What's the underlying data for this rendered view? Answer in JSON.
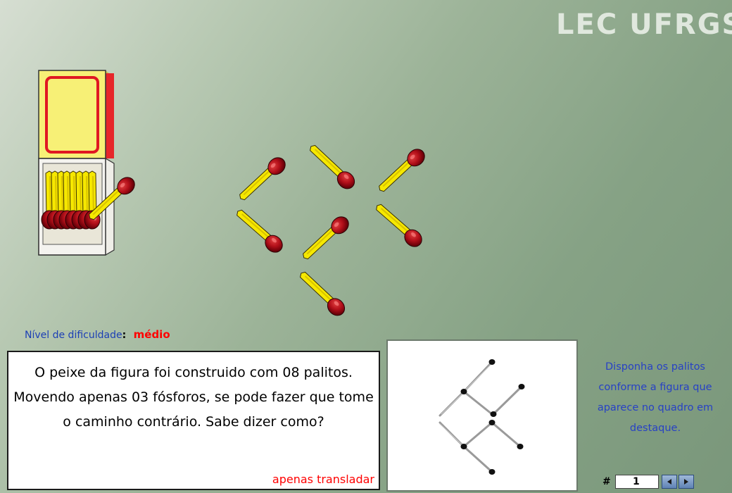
{
  "logo": {
    "text": "LEC UFRGS"
  },
  "difficulty": {
    "label": "Nível de dificuldade",
    "separator": ":",
    "level": "médio"
  },
  "problem": {
    "text": "O peixe da figura foi construido com 08 palitos. Movendo apenas 03 fósforos, se pode fazer que tome o caminho contrário. Sabe dizer como?",
    "hint_link": "apenas transladar"
  },
  "instructions": {
    "text": "Disponha os palitos conforme a figura que aparece no quadro em destaque."
  },
  "navigation": {
    "hash_label": "#",
    "current_page": "1",
    "prev_icon": "arrow-left-icon",
    "next_icon": "arrow-right-icon"
  },
  "colors": {
    "match_stick": "#f6e800",
    "match_head": "#b3101a",
    "box_yellow": "#f7f076",
    "box_red": "#e01822",
    "instruction_text": "#2741c5",
    "level_text": "#ff0000"
  }
}
